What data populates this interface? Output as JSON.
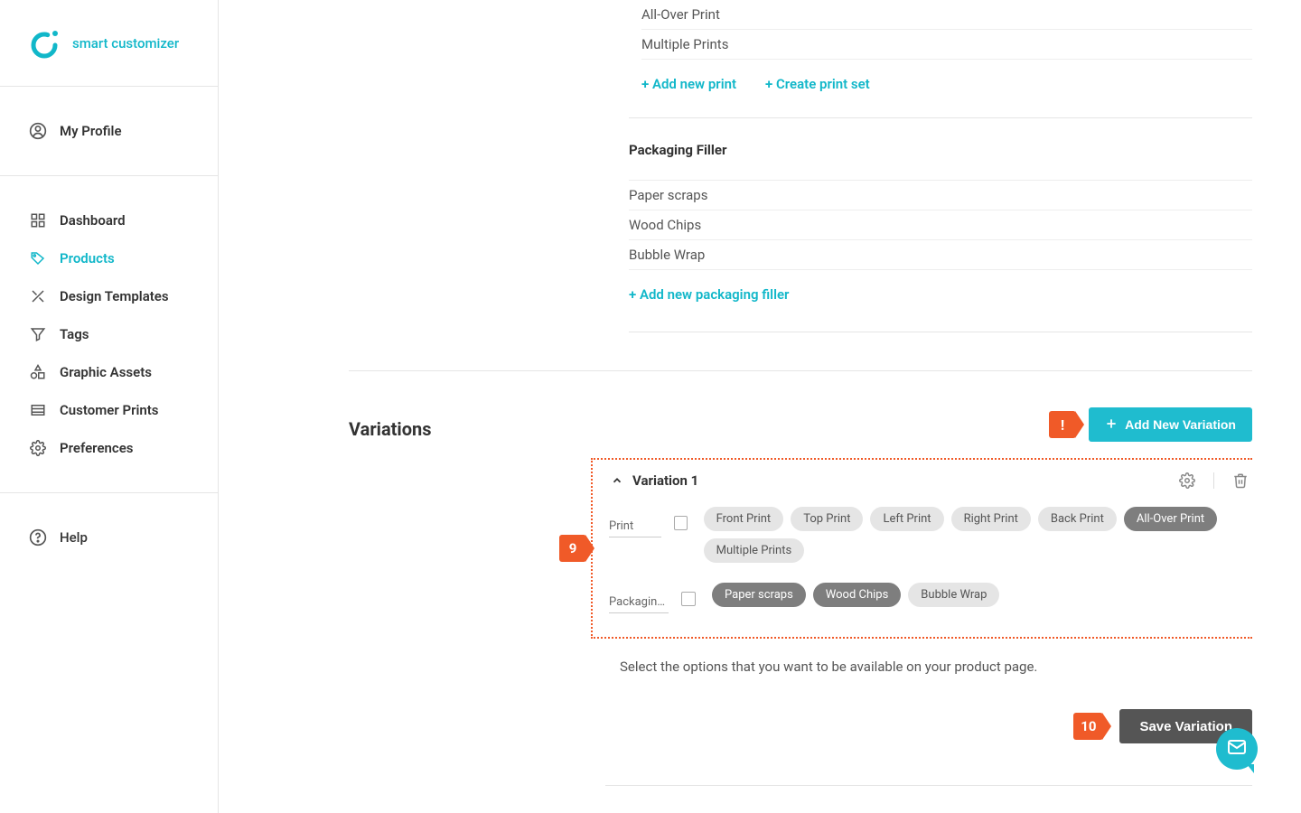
{
  "brand": {
    "name": "smart customizer"
  },
  "nav": {
    "profile": "My Profile",
    "items": [
      {
        "label": "Dashboard"
      },
      {
        "label": "Products"
      },
      {
        "label": "Design Templates"
      },
      {
        "label": "Tags"
      },
      {
        "label": "Graphic Assets"
      },
      {
        "label": "Customer Prints"
      },
      {
        "label": "Preferences"
      }
    ],
    "help": "Help"
  },
  "prints": {
    "items": [
      "All-Over Print",
      "Multiple Prints"
    ],
    "add_link": "+ Add new print",
    "createset_link": "+ Create print set"
  },
  "packaging": {
    "title": "Packaging Filler",
    "items": [
      "Paper scraps",
      "Wood Chips",
      "Bubble Wrap"
    ],
    "add_link": "+ Add new packaging filler"
  },
  "variations": {
    "title": "Variations",
    "alert_marker": "!",
    "add_button": "Add New Variation",
    "marker_9": "9",
    "v1": {
      "title": "Variation 1",
      "print_label": "Print",
      "print_chips": [
        {
          "label": "Front Print",
          "selected": false
        },
        {
          "label": "Top Print",
          "selected": false
        },
        {
          "label": "Left Print",
          "selected": false
        },
        {
          "label": "Right Print",
          "selected": false
        },
        {
          "label": "Back Print",
          "selected": false
        },
        {
          "label": "All-Over Print",
          "selected": true
        },
        {
          "label": "Multiple Prints",
          "selected": false
        }
      ],
      "pack_label": "Packaging …",
      "pack_chips": [
        {
          "label": "Paper scraps",
          "selected": true
        },
        {
          "label": "Wood Chips",
          "selected": true
        },
        {
          "label": "Bubble Wrap",
          "selected": false
        }
      ]
    },
    "help_text": "Select the options that you want to be available on your product page.",
    "marker_10": "10",
    "save_button": "Save Variation"
  }
}
